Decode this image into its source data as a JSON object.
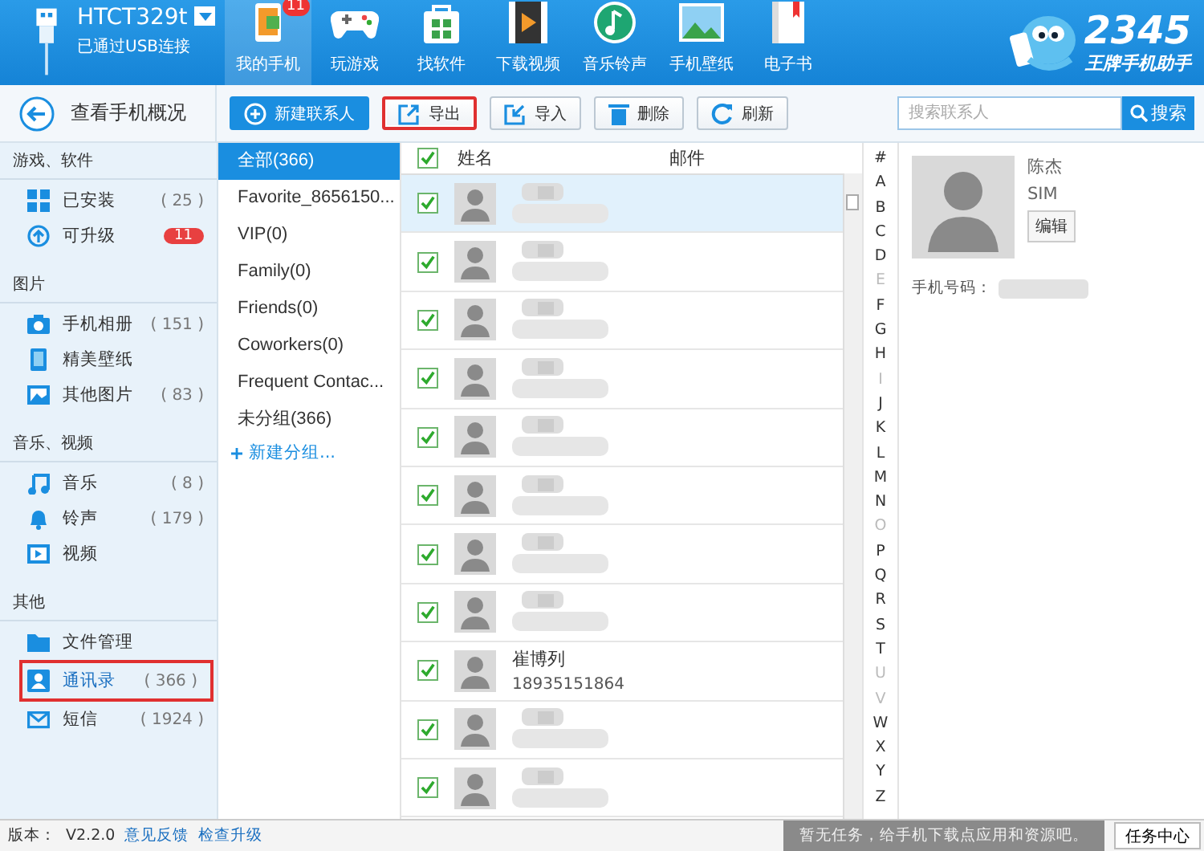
{
  "device": {
    "name": "HTCT329t",
    "status": "已通过USB连接"
  },
  "nav": [
    {
      "label": "我的手机",
      "selected": true,
      "badge": "11"
    },
    {
      "label": "玩游戏",
      "selected": false
    },
    {
      "label": "找软件",
      "selected": false
    },
    {
      "label": "下载视频",
      "selected": false
    },
    {
      "label": "音乐铃声",
      "selected": false
    },
    {
      "label": "手机壁纸",
      "selected": false
    },
    {
      "label": "电子书",
      "selected": false
    }
  ],
  "logo": {
    "title": "2345",
    "subtitle": "王牌手机助手"
  },
  "back_button": "查看手机概况",
  "toolbar": [
    {
      "label": "新建联系人",
      "kind": "primary",
      "highlighted": false
    },
    {
      "label": "导出",
      "kind": "plain",
      "highlighted": true
    },
    {
      "label": "导入",
      "kind": "plain",
      "highlighted": false
    },
    {
      "label": "删除",
      "kind": "plain",
      "highlighted": false
    },
    {
      "label": "刷新",
      "kind": "plain",
      "highlighted": false
    }
  ],
  "search": {
    "placeholder": "搜索联系人",
    "button": "搜索"
  },
  "sidebar": [
    {
      "heading": "游戏、软件",
      "items": [
        {
          "label": "已安装",
          "count": "( 25 )",
          "selected": false
        },
        {
          "label": "可升级",
          "badge": "11",
          "selected": false
        }
      ]
    },
    {
      "heading": "图片",
      "items": [
        {
          "label": "手机相册",
          "count": "( 151 )",
          "selected": false
        },
        {
          "label": "精美壁纸",
          "selected": false
        },
        {
          "label": "其他图片",
          "count": "( 83 )",
          "selected": false
        }
      ]
    },
    {
      "heading": "音乐、视频",
      "items": [
        {
          "label": "音乐",
          "count": "( 8 )",
          "selected": false
        },
        {
          "label": "铃声",
          "count": "( 179 )",
          "selected": false
        },
        {
          "label": "视频",
          "selected": false
        }
      ]
    },
    {
      "heading": "其他",
      "items": [
        {
          "label": "文件管理",
          "selected": false
        },
        {
          "label": "通讯录",
          "count": "( 366 )",
          "selected": true
        },
        {
          "label": "短信",
          "count": "( 1924 )",
          "selected": false
        }
      ]
    }
  ],
  "groups": [
    {
      "label": "全部(366)",
      "selected": true
    },
    {
      "label": "Favorite_8656150...",
      "selected": false
    },
    {
      "label": "VIP(0)",
      "selected": false
    },
    {
      "label": "Family(0)",
      "selected": false
    },
    {
      "label": "Friends(0)",
      "selected": false
    },
    {
      "label": "Coworkers(0)",
      "selected": false
    },
    {
      "label": "Frequent Contac...",
      "selected": false
    },
    {
      "label": "未分组(366)",
      "selected": false
    }
  ],
  "new_group": "新建分组...",
  "table": {
    "all_checked": true,
    "columns": [
      "姓名",
      "邮件"
    ],
    "rows": [
      {
        "kind": "redacted",
        "checked": true,
        "selected": true
      },
      {
        "kind": "redacted",
        "checked": true,
        "selected": false
      },
      {
        "kind": "redacted",
        "checked": true,
        "selected": false
      },
      {
        "kind": "redacted",
        "checked": true,
        "selected": false
      },
      {
        "kind": "redacted",
        "checked": true,
        "selected": false
      },
      {
        "kind": "redacted",
        "checked": true,
        "selected": false
      },
      {
        "kind": "redacted",
        "checked": true,
        "selected": false
      },
      {
        "kind": "redacted",
        "checked": true,
        "selected": false
      },
      {
        "kind": "contact",
        "name": "崔博列",
        "phone": "18935151864",
        "checked": true,
        "selected": false
      },
      {
        "kind": "redacted",
        "checked": true,
        "selected": false
      },
      {
        "kind": "redacted",
        "checked": true,
        "selected": false
      }
    ]
  },
  "alphabet": [
    {
      "letter": "#",
      "disabled": false
    },
    {
      "letter": "A",
      "disabled": false
    },
    {
      "letter": "B",
      "disabled": false
    },
    {
      "letter": "C",
      "disabled": false
    },
    {
      "letter": "D",
      "disabled": false
    },
    {
      "letter": "E",
      "disabled": true
    },
    {
      "letter": "F",
      "disabled": false
    },
    {
      "letter": "G",
      "disabled": false
    },
    {
      "letter": "H",
      "disabled": false
    },
    {
      "letter": "I",
      "disabled": true
    },
    {
      "letter": "J",
      "disabled": false
    },
    {
      "letter": "K",
      "disabled": false
    },
    {
      "letter": "L",
      "disabled": false
    },
    {
      "letter": "M",
      "disabled": false
    },
    {
      "letter": "N",
      "disabled": false
    },
    {
      "letter": "O",
      "disabled": true
    },
    {
      "letter": "P",
      "disabled": false
    },
    {
      "letter": "Q",
      "disabled": false
    },
    {
      "letter": "R",
      "disabled": false
    },
    {
      "letter": "S",
      "disabled": false
    },
    {
      "letter": "T",
      "disabled": false
    },
    {
      "letter": "U",
      "disabled": true
    },
    {
      "letter": "V",
      "disabled": true
    },
    {
      "letter": "W",
      "disabled": false
    },
    {
      "letter": "X",
      "disabled": false
    },
    {
      "letter": "Y",
      "disabled": false
    },
    {
      "letter": "Z",
      "disabled": false
    }
  ],
  "detail": {
    "name": "陈杰",
    "source": "SIM",
    "edit_button": "编辑",
    "phone_label": "手机号码："
  },
  "status_bar": {
    "version_label": "版本：",
    "version": "V2.2.0",
    "links": [
      "意见反馈",
      "检查升级"
    ],
    "task_message": "暂无任务，给手机下载点应用和资源吧。",
    "task_button": "任务中心"
  }
}
